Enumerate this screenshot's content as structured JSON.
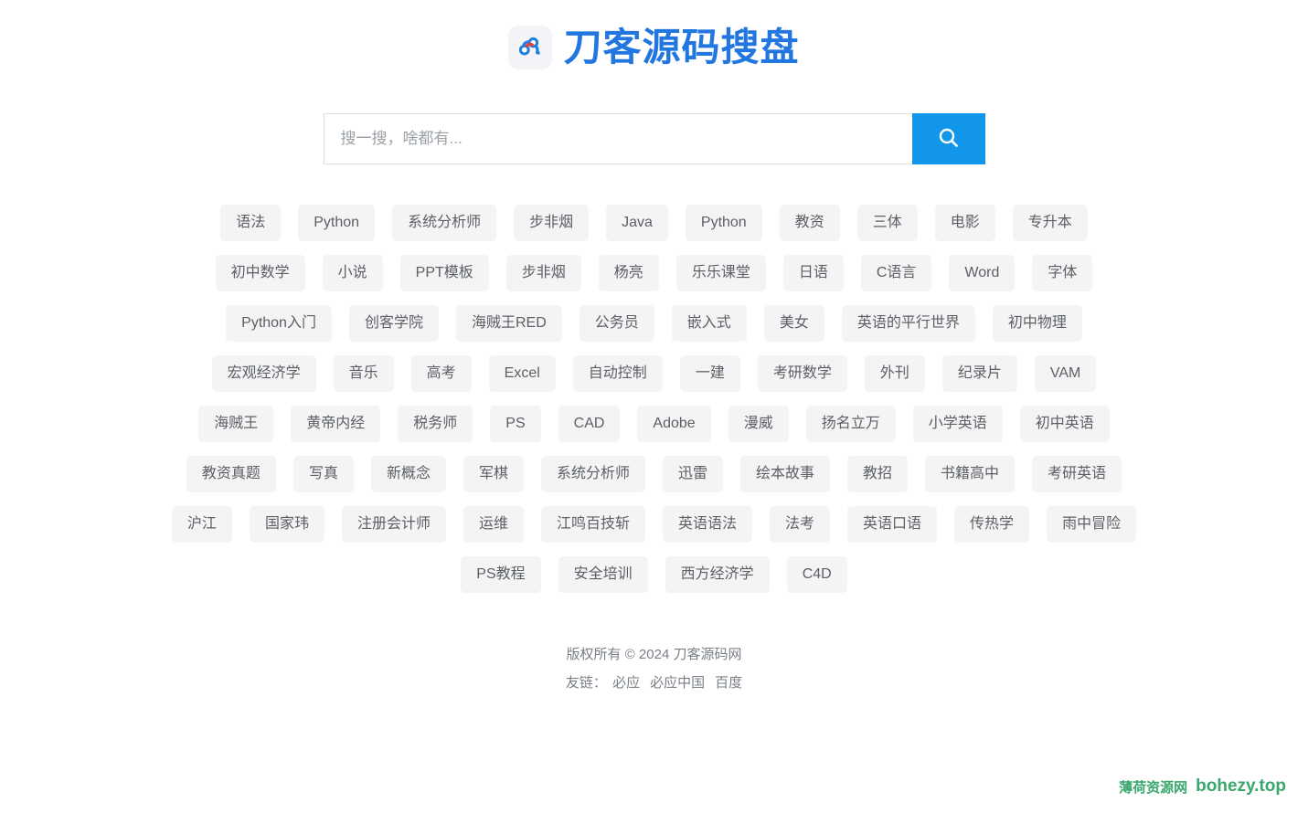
{
  "site": {
    "logo_icon": "baidu-cloud-icon",
    "title": "刀客源码搜盘",
    "brand_color": "#2176e0",
    "accent_color": "#1296ea"
  },
  "search": {
    "placeholder": "搜一搜，啥都有...",
    "value": "",
    "button_icon": "search-icon",
    "button_label": ""
  },
  "tag_rows": [
    [
      "语法",
      "Python",
      "系统分析师",
      "步非烟",
      "Java",
      "Python",
      "教资",
      "三体",
      "电影",
      "专升本"
    ],
    [
      "初中数学",
      "小说",
      "PPT模板",
      "步非烟",
      "杨亮",
      "乐乐课堂",
      "日语",
      "C语言",
      "Word",
      "字体"
    ],
    [
      "Python入门",
      "创客学院",
      "海贼王RED",
      "公务员",
      "嵌入式",
      "美女",
      "英语的平行世界",
      "初中物理"
    ],
    [
      "宏观经济学",
      "音乐",
      "高考",
      "Excel",
      "自动控制",
      "一建",
      "考研数学",
      "外刊",
      "纪录片",
      "VAM"
    ],
    [
      "海贼王",
      "黄帝内经",
      "税务师",
      "PS",
      "CAD",
      "Adobe",
      "漫威",
      "扬名立万",
      "小学英语",
      "初中英语"
    ],
    [
      "教资真题",
      "写真",
      "新概念",
      "军棋",
      "系统分析师",
      "迅雷",
      "绘本故事",
      "教招",
      "书籍高中",
      "考研英语"
    ],
    [
      "沪江",
      "国家玮",
      "注册会计师",
      "运维",
      "江鸣百技斩",
      "英语语法",
      "法考",
      "英语口语",
      "传热学",
      "雨中冒险"
    ],
    [
      "PS教程",
      "安全培训",
      "西方经济学",
      "C4D"
    ]
  ],
  "footer": {
    "copyright": "版权所有 © 2024 刀客源码网",
    "friend_label": "友链：",
    "friend_links": [
      "必应",
      "必应中国",
      "百度"
    ]
  },
  "watermark": {
    "cn_text": "薄荷资源网",
    "url_text": "bohezy.top",
    "color": "#3aa76d"
  }
}
